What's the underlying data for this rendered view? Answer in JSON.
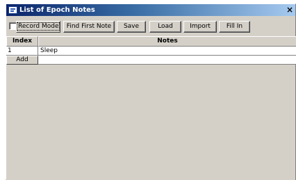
{
  "window": {
    "title": "List of Epoch Notes",
    "close_glyph": "×"
  },
  "toolbar": {
    "record_mode_label": "Record Mode",
    "record_mode_checked": false,
    "find_first_note_label": "Find First Note",
    "save_label": "Save",
    "load_label": "Load",
    "import_label": "Import",
    "fill_in_label": "Fill In"
  },
  "table": {
    "columns": [
      "Index",
      "Notes"
    ],
    "rows": [
      {
        "index": "1",
        "notes": "Sleep"
      }
    ],
    "add_label": "Add"
  },
  "icons": {
    "title_icon": "window-app-icon",
    "close_icon": "close-icon",
    "checkbox_icon": "checkbox-unchecked-icon"
  },
  "colors": {
    "titlebar_start": "#0a246a",
    "titlebar_end": "#a6caf0",
    "face": "#d4d0c8",
    "cell_bg": "#ffffff"
  }
}
